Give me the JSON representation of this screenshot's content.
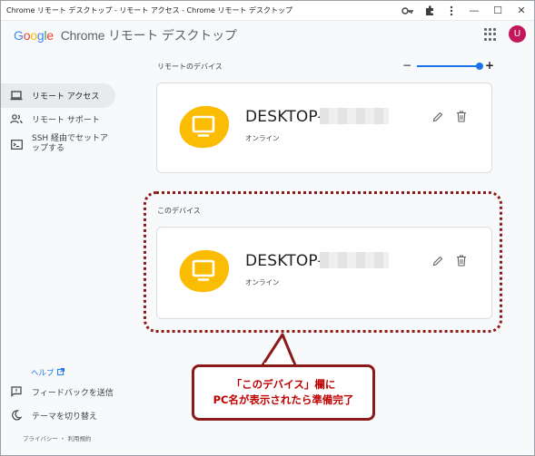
{
  "window": {
    "title": "Chrome リモート デスクトップ - リモート アクセス - Chrome リモート デスクトップ",
    "minimize_glyph": "—",
    "maximize_glyph": "☐",
    "close_glyph": "✕"
  },
  "header": {
    "logo_google": [
      "G",
      "o",
      "o",
      "g",
      "l",
      "e"
    ],
    "product_name": "Chrome リモート デスクトップ",
    "avatar_letter": "U",
    "avatar_color": "#c2185b"
  },
  "sidebar": {
    "items": [
      {
        "label": "リモート アクセス",
        "icon": "laptop-icon",
        "active": true
      },
      {
        "label": "リモート サポート",
        "icon": "people-icon",
        "active": false
      },
      {
        "label": "SSH 経由でセットアップする",
        "icon": "terminal-icon",
        "active": false
      }
    ],
    "help_label": "ヘルプ",
    "footer_items": [
      {
        "label": "フィードバックを送信",
        "icon": "feedback-icon"
      },
      {
        "label": "テーマを切り替え",
        "icon": "moon-icon"
      }
    ],
    "legal_text": "プライバシー ・ 利用規約"
  },
  "main": {
    "remote_devices_label": "リモートのデバイス",
    "this_device_label": "このデバイス",
    "zoom_minus": "−",
    "zoom_plus": "+",
    "devices": [
      {
        "name": "DESKTOP-",
        "status": "オンライン"
      },
      {
        "name": "DESKTOP-",
        "status": "オンライン"
      }
    ]
  },
  "annotation": {
    "line1": "「このデバイス」欄に",
    "line2": "PC名が表示されたら準備完了",
    "color": "#8b1a1a"
  },
  "colors": {
    "accent": "#1a73e8",
    "device_blob": "#fbbc04",
    "annotation_text": "#c00000"
  }
}
